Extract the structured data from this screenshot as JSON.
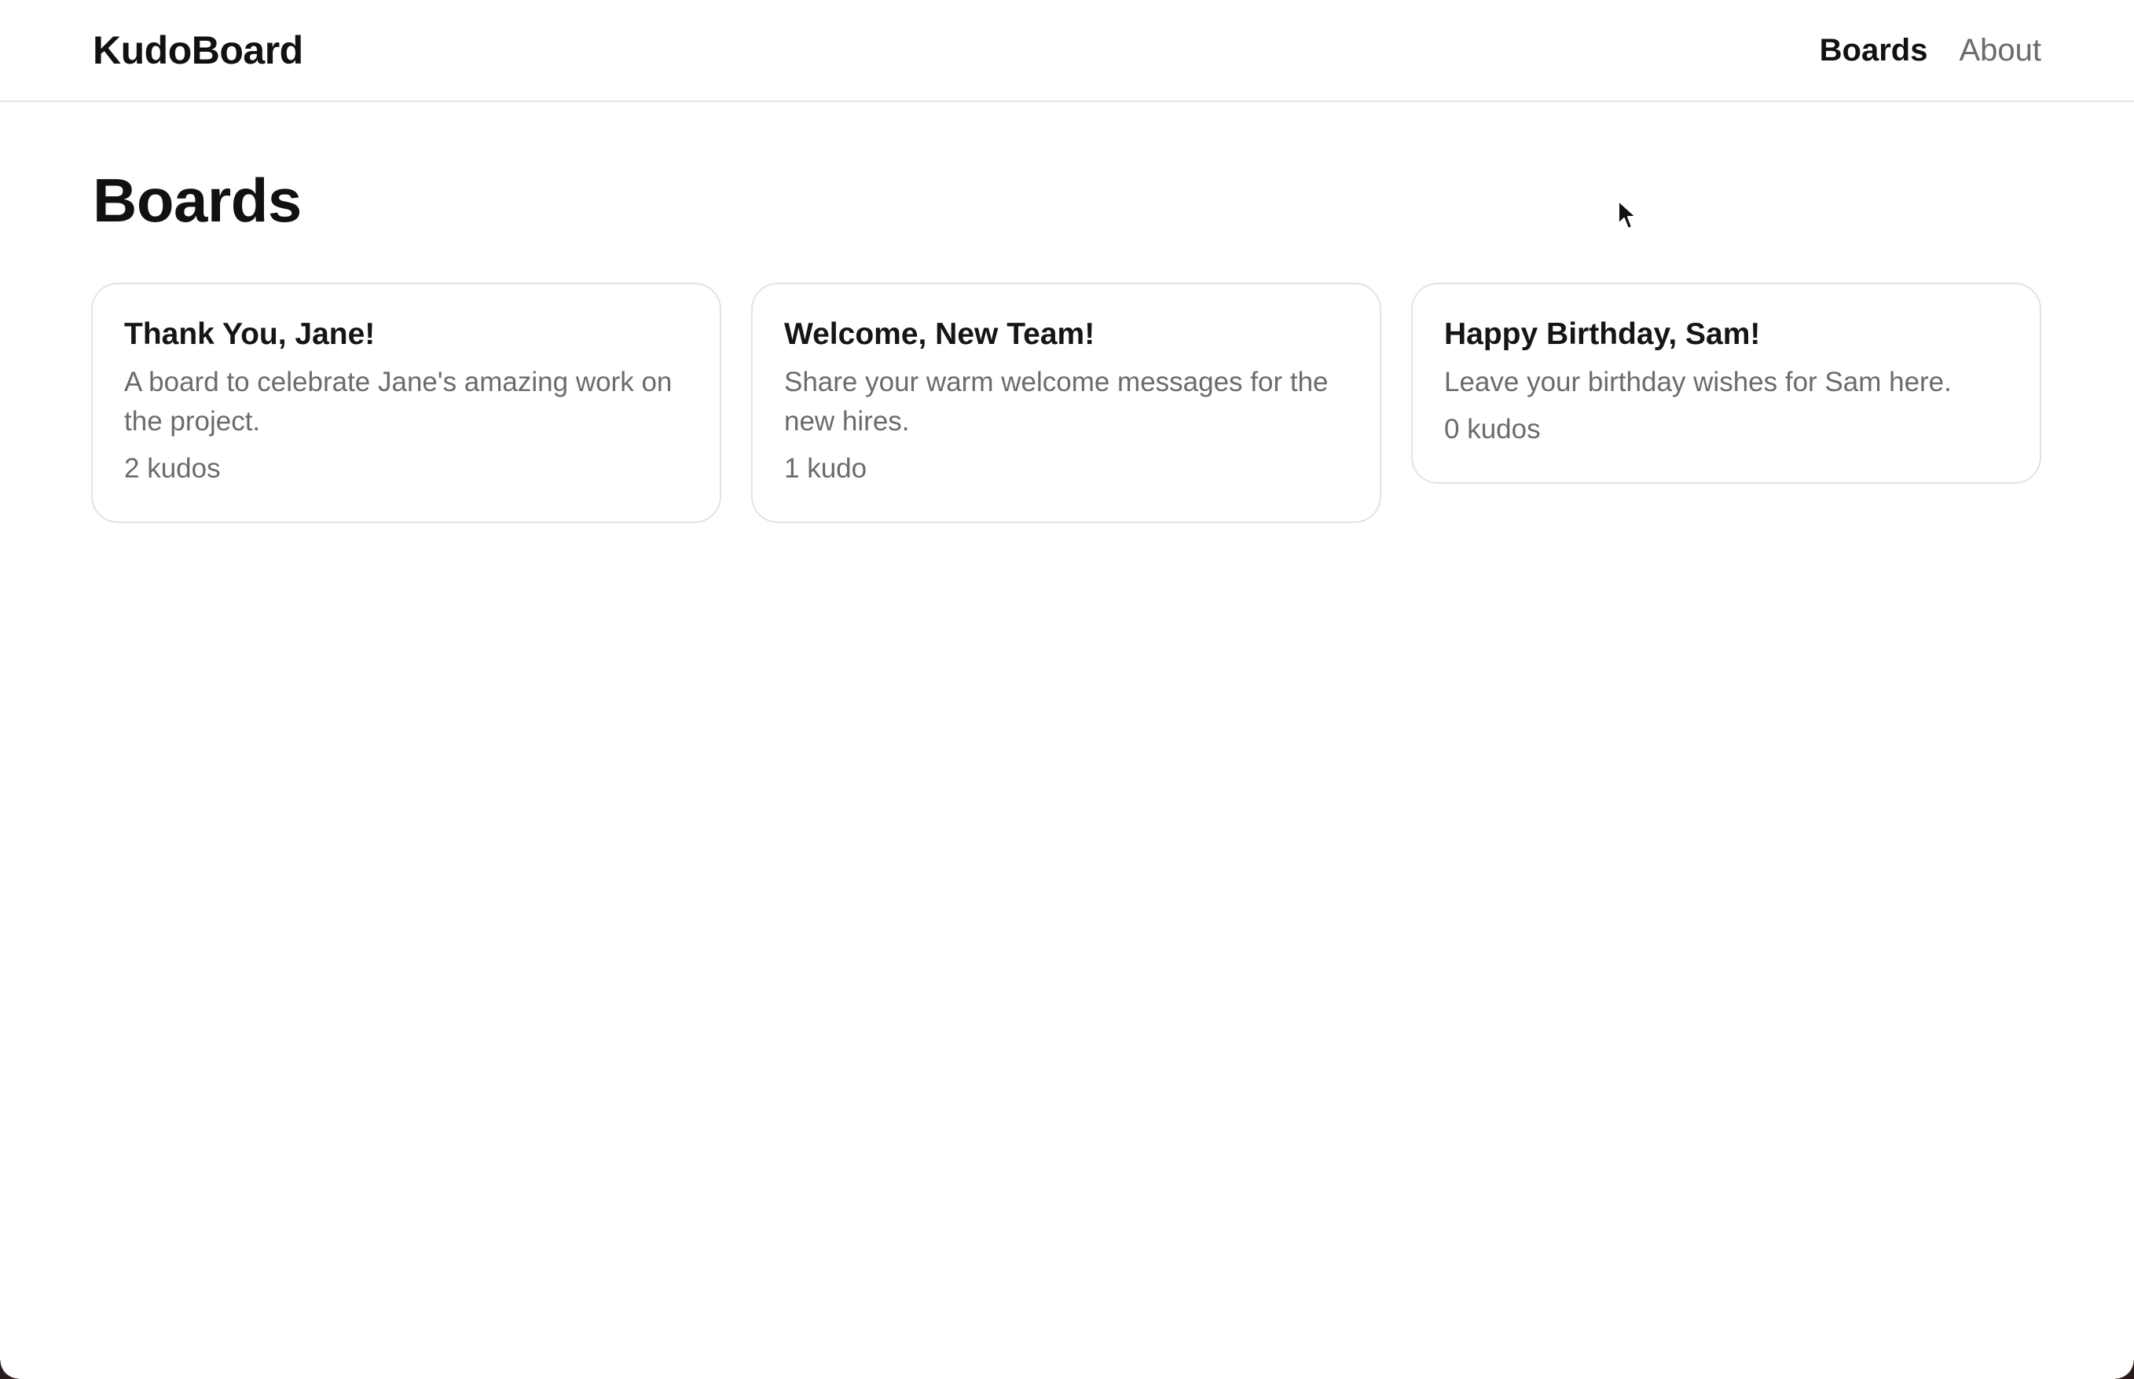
{
  "app": {
    "brand": "KudoBoard"
  },
  "nav": {
    "items": [
      {
        "label": "Boards",
        "active": true
      },
      {
        "label": "About",
        "active": false
      }
    ]
  },
  "main": {
    "title": "Boards",
    "boards": [
      {
        "title": "Thank You, Jane!",
        "description": "A board to celebrate Jane's amazing work on the project.",
        "count": "2 kudos"
      },
      {
        "title": "Welcome, New Team!",
        "description": "Share your warm welcome messages for the new hires.",
        "count": "1 kudo"
      },
      {
        "title": "Happy Birthday, Sam!",
        "description": "Leave your birthday wishes for Sam here.",
        "count": "0 kudos"
      }
    ]
  },
  "colors": {
    "text": "#111111",
    "muted": "#6b6b6b",
    "border": "#e3e3e3",
    "background": "#ffffff"
  },
  "icons": {
    "cursor": "mouse-pointer-icon"
  }
}
